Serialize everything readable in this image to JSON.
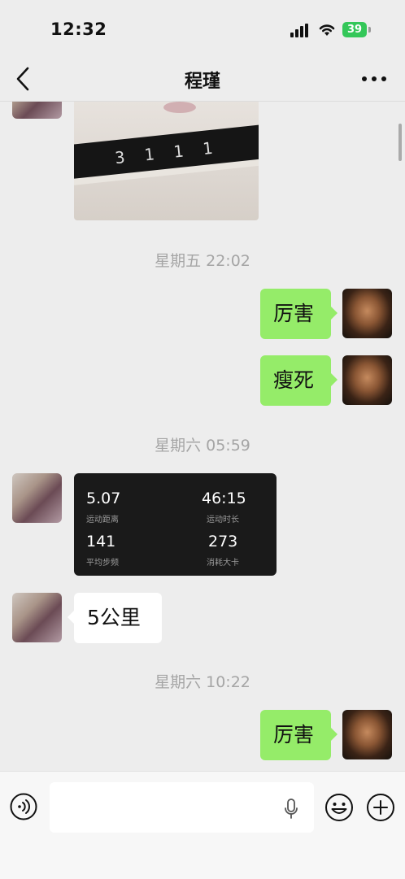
{
  "status_bar": {
    "time": "12:32",
    "battery": "39"
  },
  "nav": {
    "title": "程瑾"
  },
  "messages": {
    "ts1": "星期五 22:02",
    "me1": "厉害",
    "me2": "瘦死",
    "ts2": "星期六 05:59",
    "sport": {
      "distance": "5.07",
      "distance_label": "运动距离",
      "duration": "46:15",
      "duration_label": "运动时长",
      "cadence": "141",
      "cadence_label": "平均步频",
      "calories": "273",
      "calories_label": "消耗大卡"
    },
    "her1": "5公里",
    "ts3": "星期六 10:22",
    "me3": "厉害"
  },
  "input": {
    "value": ""
  },
  "icons": {
    "back": "chevron-left-icon",
    "more": "ellipsis-icon",
    "voice": "voice-icon",
    "mic": "microphone-icon",
    "emoji": "emoji-icon",
    "plus": "plus-icon"
  },
  "colors": {
    "my_bubble": "#95ec69",
    "her_bubble": "#ffffff",
    "background": "#ededed"
  }
}
